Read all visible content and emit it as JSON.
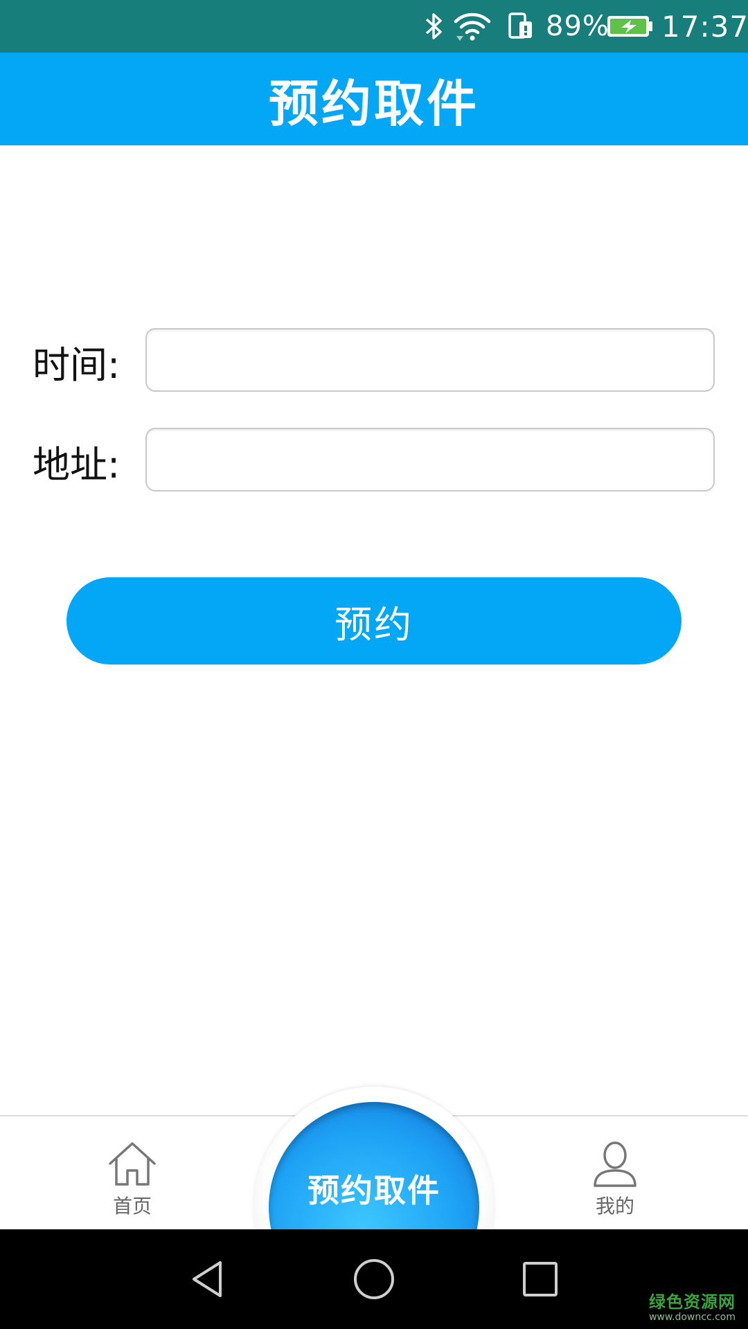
{
  "status_bar": {
    "battery_percent": "89%",
    "time": "17:37",
    "icons": [
      "bluetooth-icon",
      "wifi-icon",
      "sim-icon",
      "battery-charging-icon"
    ]
  },
  "header": {
    "title": "预约取件"
  },
  "form": {
    "time_label": "时间:",
    "time_value": "",
    "address_label": "地址:",
    "address_value": "",
    "submit_label": "预约"
  },
  "tab_bar": {
    "home_label": "首页",
    "center_label": "预约取件",
    "mine_label": "我的"
  },
  "nav_bar": {
    "icons": [
      "back-icon",
      "home-circle-icon",
      "recents-icon"
    ]
  },
  "watermark": {
    "main": "绿色资源网",
    "sub": "www.downcc.com"
  },
  "colors": {
    "status_bar": "#177e7c",
    "accent": "#04a7f5",
    "nav_bar": "#000000"
  }
}
